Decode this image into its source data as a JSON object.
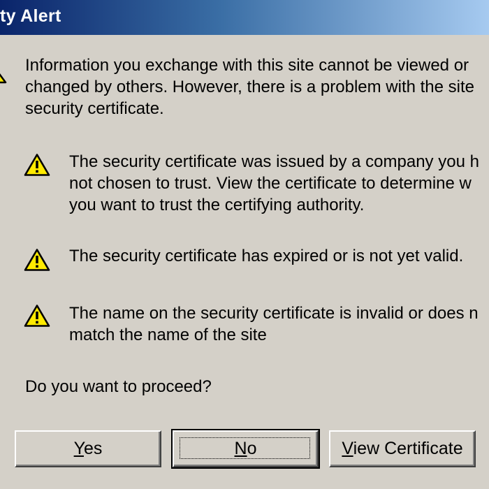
{
  "window": {
    "title": "ty Alert"
  },
  "message": {
    "line1": "Information you exchange with this site cannot be viewed or",
    "line2": "changed by others. However, there is a problem with the site",
    "line3": "security certificate."
  },
  "warnings": [
    {
      "line1": "The security certificate was issued by a company you h",
      "line2": "not chosen to trust. View the certificate to determine w",
      "line3": "you want to trust the certifying authority."
    },
    {
      "line1": "The security certificate has expired or is not yet valid."
    },
    {
      "line1": "The name on the security certificate is invalid or does n",
      "line2": "match the name of the site"
    }
  ],
  "prompt": "Do you want to proceed?",
  "buttons": {
    "yes": {
      "mnemonic": "Y",
      "rest": "es"
    },
    "no": {
      "mnemonic": "N",
      "rest": "o"
    },
    "view": {
      "mnemonic": "V",
      "rest": "iew Certificate"
    }
  },
  "icons": {
    "warning": "warning-triangle-icon"
  },
  "colors": {
    "dialog_background": "#d4d0c8",
    "titlebar_start": "#0a246a",
    "titlebar_end": "#a6caf0",
    "warning_yellow": "#ffea00"
  }
}
